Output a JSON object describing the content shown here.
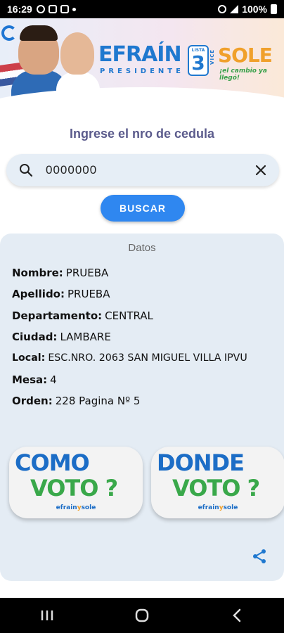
{
  "status_bar": {
    "time": "16:29",
    "battery": "100%"
  },
  "banner": {
    "name_main": "EFRAÍN",
    "role_main": "PRESIDENTE",
    "list_label": "LISTA",
    "list_number": "3",
    "vice_label": "VICE",
    "name_vice": "SOLE",
    "slogan": "¡el cambio ya llegó!"
  },
  "form": {
    "title": "Ingrese el nro de cedula",
    "search_value": "0000000",
    "search_button": "BUSCAR"
  },
  "datos": {
    "title": "Datos",
    "rows": [
      {
        "label": "Nombre:",
        "value": "PRUEBA"
      },
      {
        "label": "Apellido:",
        "value": "PRUEBA"
      },
      {
        "label": "Departamento:",
        "value": "CENTRAL"
      },
      {
        "label": "Ciudad:",
        "value": "LAMBARE"
      },
      {
        "label": "Local:",
        "value": "ESC.NRO. 2063 SAN MIGUEL VILLA IPVU"
      },
      {
        "label": "Mesa:",
        "value": "4"
      },
      {
        "label": "Orden:",
        "value": "228 Pagina Nº 5"
      }
    ]
  },
  "promos": [
    {
      "line1": "COMO",
      "line2": "VOTO ?",
      "brand_a": "efrain",
      "brand_y": "y",
      "brand_b": "sole"
    },
    {
      "line1": "DONDE",
      "line2": "VOTO ?",
      "brand_a": "efrain",
      "brand_y": "y",
      "brand_b": "sole"
    }
  ],
  "colors": {
    "accent": "#2f87f0",
    "card_bg": "#e4ecf4",
    "brand_blue": "#1c6dc6",
    "brand_green": "#39a84a"
  }
}
